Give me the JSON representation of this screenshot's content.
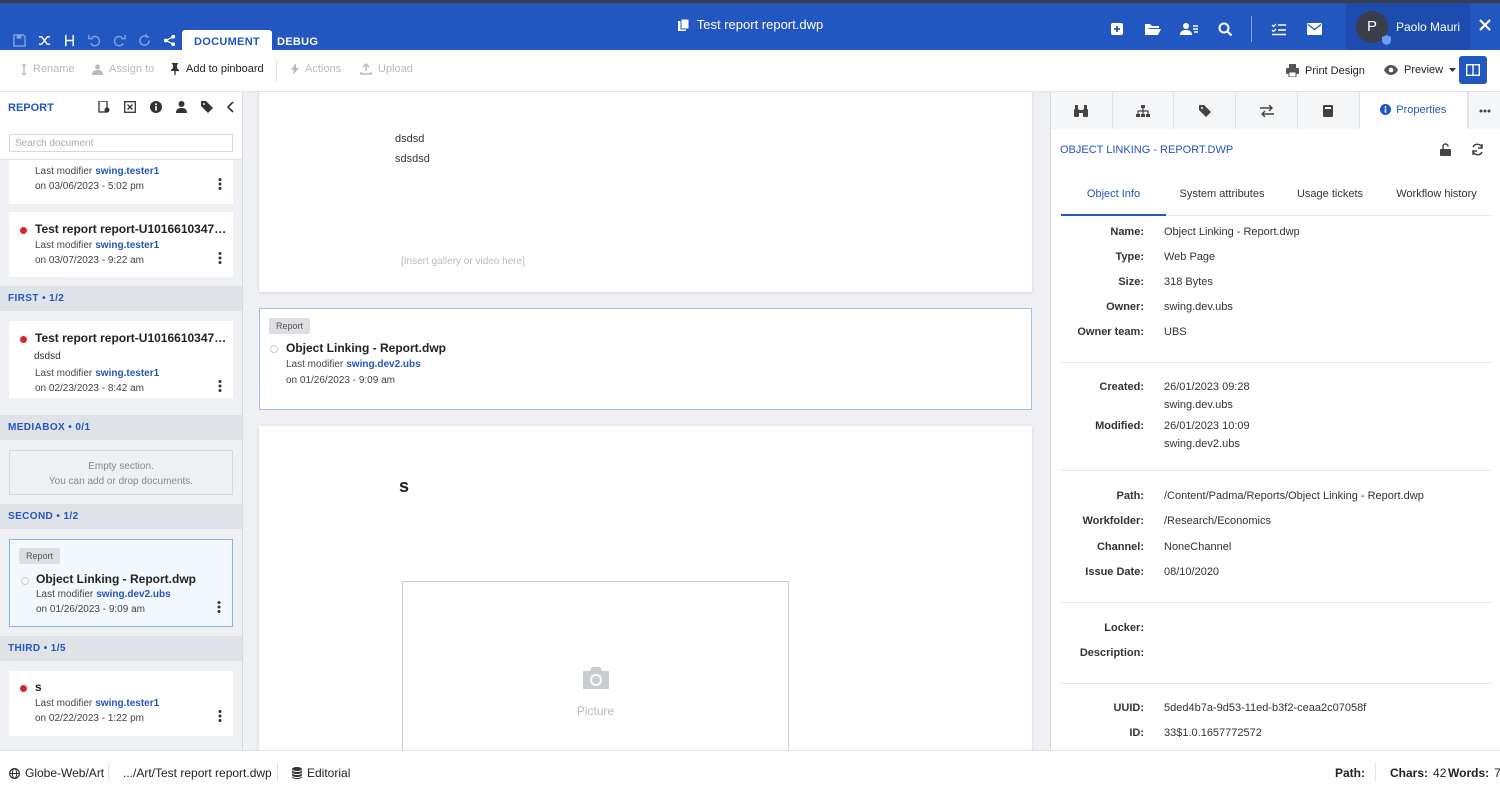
{
  "window": {
    "title": "Test report report.dwp"
  },
  "tabs": {
    "document": "DOCUMENT",
    "debug": "DEBUG"
  },
  "user": {
    "initial": "P",
    "name": "Paolo Mauri"
  },
  "toolbar": {
    "rename": "Rename",
    "assign": "Assign to",
    "pinboard": "Add to pinboard",
    "actions": "Actions",
    "upload": "Upload",
    "print": "Print Design",
    "preview": "Preview"
  },
  "left": {
    "title": "REPORT",
    "search_placeholder": "Search document",
    "cards": [
      {
        "modifier_label": "Last modifier",
        "modifier": "swing.tester1",
        "date": "on 03/06/2023 - 5:02 pm"
      },
      {
        "title": "Test report report-U101661034760...",
        "modifier_label": "Last modifier",
        "modifier": "swing.tester1",
        "date": "on 03/07/2023 - 9:22 am"
      },
      {
        "title": "Test report report-U101661034760...",
        "subtitle": "dsdsd",
        "modifier_label": "Last modifier",
        "modifier": "swing.tester1",
        "date": "on 02/23/2023 - 8:42 am"
      },
      {
        "badge": "Report",
        "title": "Object Linking - Report.dwp",
        "modifier_label": "Last modifier",
        "modifier": "swing.dev2.ubs",
        "date": "on 01/26/2023 - 9:09 am"
      },
      {
        "title": "s",
        "modifier_label": "Last modifier",
        "modifier": "swing.tester1",
        "date": "on 02/22/2023 - 1:22 pm"
      }
    ],
    "sections": {
      "first": "FIRST • 1/2",
      "mediabox": "MEDIABOX • 0/1",
      "second": "SECOND • 1/2",
      "third": "THIRD • 1/5"
    },
    "empty_line1": "Empty section.",
    "empty_line2": "You can add or drop documents."
  },
  "center": {
    "line1": "dsdsd",
    "line2": "sdsdsd",
    "gallery": "[Insert gallery or video here]",
    "ref": {
      "badge": "Report",
      "title": "Object Linking - Report.dwp",
      "modifier_label": "Last modifier",
      "modifier": "swing.dev2.ubs",
      "date": "on 01/26/2023 - 9:09 am"
    },
    "heading": "s",
    "picture": "Picture"
  },
  "right": {
    "properties_tab": "Properties",
    "title": "OBJECT LINKING - REPORT.DWP",
    "subtabs": [
      "Object Info",
      "System attributes",
      "Usage tickets",
      "Workflow history"
    ],
    "props": {
      "name": {
        "k": "Name:",
        "v": "Object Linking - Report.dwp"
      },
      "type": {
        "k": "Type:",
        "v": "Web Page"
      },
      "size": {
        "k": "Size:",
        "v": "318 Bytes"
      },
      "owner": {
        "k": "Owner:",
        "v": "swing.dev.ubs"
      },
      "owner_team": {
        "k": "Owner team:",
        "v": "UBS"
      },
      "created": {
        "k": "Created:",
        "v": "26/01/2023 09:28",
        "v2": "swing.dev.ubs"
      },
      "modified": {
        "k": "Modified:",
        "v": "26/01/2023 10:09",
        "v2": "swing.dev2.ubs"
      },
      "path": {
        "k": "Path:",
        "v": "/Content/Padma/Reports/Object Linking - Report.dwp"
      },
      "workfolder": {
        "k": "Workfolder:",
        "v": "/Research/Economics"
      },
      "channel": {
        "k": "Channel:",
        "v": "NoneChannel"
      },
      "issue_date": {
        "k": "Issue Date:",
        "v": "08/10/2020"
      },
      "locker": {
        "k": "Locker:",
        "v": ""
      },
      "description": {
        "k": "Description:",
        "v": ""
      },
      "uuid": {
        "k": "UUID:",
        "v": "5ded4b7a-9d53-11ed-b3f2-ceaa2c07058f"
      },
      "id": {
        "k": "ID:",
        "v": "33$1.0.1657772572"
      }
    }
  },
  "status": {
    "site": "Globe-Web/Art",
    "path_short": ".../Art/Test report report.dwp",
    "editorial": "Editorial",
    "path_label": "Path:",
    "chars_label": "Chars:",
    "chars": "42",
    "words_label": "Words:",
    "words": "7"
  }
}
